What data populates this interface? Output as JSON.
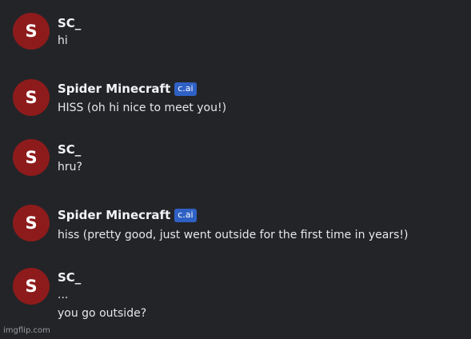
{
  "messages": [
    {
      "avatar_letter": "S",
      "author": "SC_",
      "badge": "",
      "lines": [
        "hi"
      ]
    },
    {
      "avatar_letter": "S",
      "author": "Spider Minecraft",
      "badge": "c.ai",
      "lines": [
        "HISS (oh hi nice to meet you!)"
      ]
    },
    {
      "avatar_letter": "S",
      "author": "SC_",
      "badge": "",
      "lines": [
        "hru?"
      ]
    },
    {
      "avatar_letter": "S",
      "author": "Spider Minecraft",
      "badge": "c.ai",
      "lines": [
        "hiss (pretty good, just went outside for the first time in years!)"
      ]
    },
    {
      "avatar_letter": "S",
      "author": "SC_",
      "badge": "",
      "lines": [
        "...",
        "you go outside?"
      ]
    }
  ],
  "watermark": "imgflip.com",
  "colors": {
    "background": "#232428",
    "avatar": "#8e1b1b",
    "badge": "#2f61c5",
    "text": "#e6e7ea"
  }
}
